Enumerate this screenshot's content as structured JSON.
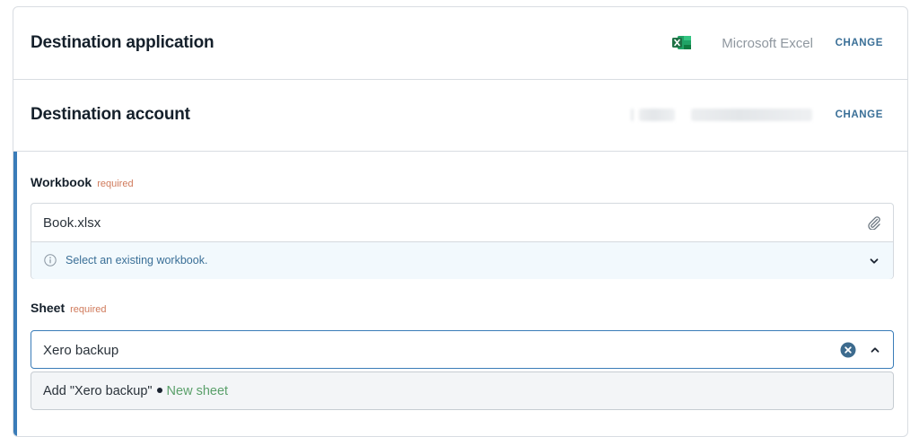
{
  "destination_application": {
    "title": "Destination application",
    "app_name": "Microsoft Excel",
    "change_label": "CHANGE",
    "icon": "excel-icon"
  },
  "destination_account": {
    "title": "Destination account",
    "change_label": "CHANGE"
  },
  "workbook": {
    "label": "Workbook",
    "required_label": "required",
    "value": "Book.xlsx",
    "hint": "Select an existing workbook."
  },
  "sheet": {
    "label": "Sheet",
    "required_label": "required",
    "value": "Xero backup",
    "option_add": "Add \"Xero backup\"",
    "option_tag": "New sheet"
  },
  "colors": {
    "accent": "#3a7cb8",
    "link": "#3a6f97",
    "required": "#d07a5b",
    "new_tag": "#5aa06a",
    "excel_green": "#1e7145"
  }
}
